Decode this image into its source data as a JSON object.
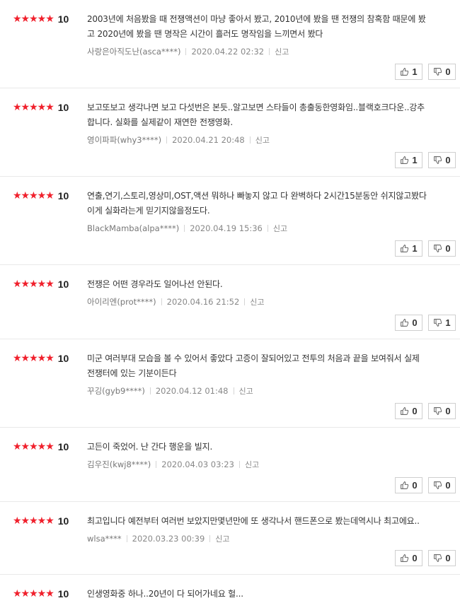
{
  "reviews": [
    {
      "stars": "★★★★★",
      "score": "10",
      "text": "2003년에 처음봤을 때 전쟁액션이 마냥 좋아서 봤고, 2010년에 봤을 땐 전쟁의 참혹함 때문에 봤\n고 2020년에 봤을 땐 명작은 시간이 흘러도 명작임을 느끼면서 봤다",
      "author": "사랑은아직도난(asca****)",
      "date": "2020.04.22 02:32",
      "report": "신고",
      "likes": "1",
      "dislikes": "0"
    },
    {
      "stars": "★★★★★",
      "score": "10",
      "text": "보고또보고 생각나면 보고 다섯번은 본듯..알고보면 스타들이 총출동한영화임..블랙호크다운..강추\n합니다. 실화를 실제같이 재연한 전쟁영화.",
      "author": "영이파파(why3****)",
      "date": "2020.04.21 20:48",
      "report": "신고",
      "likes": "1",
      "dislikes": "0"
    },
    {
      "stars": "★★★★★",
      "score": "10",
      "text": "연출,연기,스토리,영상미,OST,액션 뭐하나 빠놓지 않고 다 완벽하다 2시간15분동안 쉬지않고봤다\n이게 실화라는게 믿기지않을정도다.",
      "author": "BlackMamba(alpa****)",
      "date": "2020.04.19 15:36",
      "report": "신고",
      "likes": "1",
      "dislikes": "0"
    },
    {
      "stars": "★★★★★",
      "score": "10",
      "text": "전쟁은 어떤 경우라도 일어나선 안된다.",
      "author": "아이리엔(prot****)",
      "date": "2020.04.16 21:52",
      "report": "신고",
      "likes": "0",
      "dislikes": "1"
    },
    {
      "stars": "★★★★★",
      "score": "10",
      "text": "미군 여러부대 모습을 볼 수 있어서 좋았다 고증이 잘되어있고 전투의 처음과 끝을 보여줘서 실제\n전쟁터에 있는 기분이든다",
      "author": "꾸깅(gyb9****)",
      "date": "2020.04.12 01:48",
      "report": "신고",
      "likes": "0",
      "dislikes": "0"
    },
    {
      "stars": "★★★★★",
      "score": "10",
      "text": "고든이 죽었어. 난 간다 행운을 빌지.",
      "author": "김우진(kwj8****)",
      "date": "2020.04.03 03:23",
      "report": "신고",
      "likes": "0",
      "dislikes": "0"
    },
    {
      "stars": "★★★★★",
      "score": "10",
      "text": "최고입니다 예전부터 여러번 보았지만몇년만에 또 생각나서 핸드폰으로 봤는데역시나 최고에요..",
      "author": "wlsa****",
      "date": "2020.03.23 00:39",
      "report": "신고",
      "likes": "0",
      "dislikes": "0"
    },
    {
      "stars": "★★★★★",
      "score": "10",
      "text": "인생영화중 하나..20년이 다 되어가네요 헐...",
      "author": "",
      "date": "",
      "report": "",
      "likes": "",
      "dislikes": ""
    }
  ],
  "icons": {
    "like": "thumbs-up-icon",
    "dislike": "thumbs-down-icon"
  },
  "colors": {
    "star": "#f0202c",
    "border": "#e9e9e9"
  }
}
